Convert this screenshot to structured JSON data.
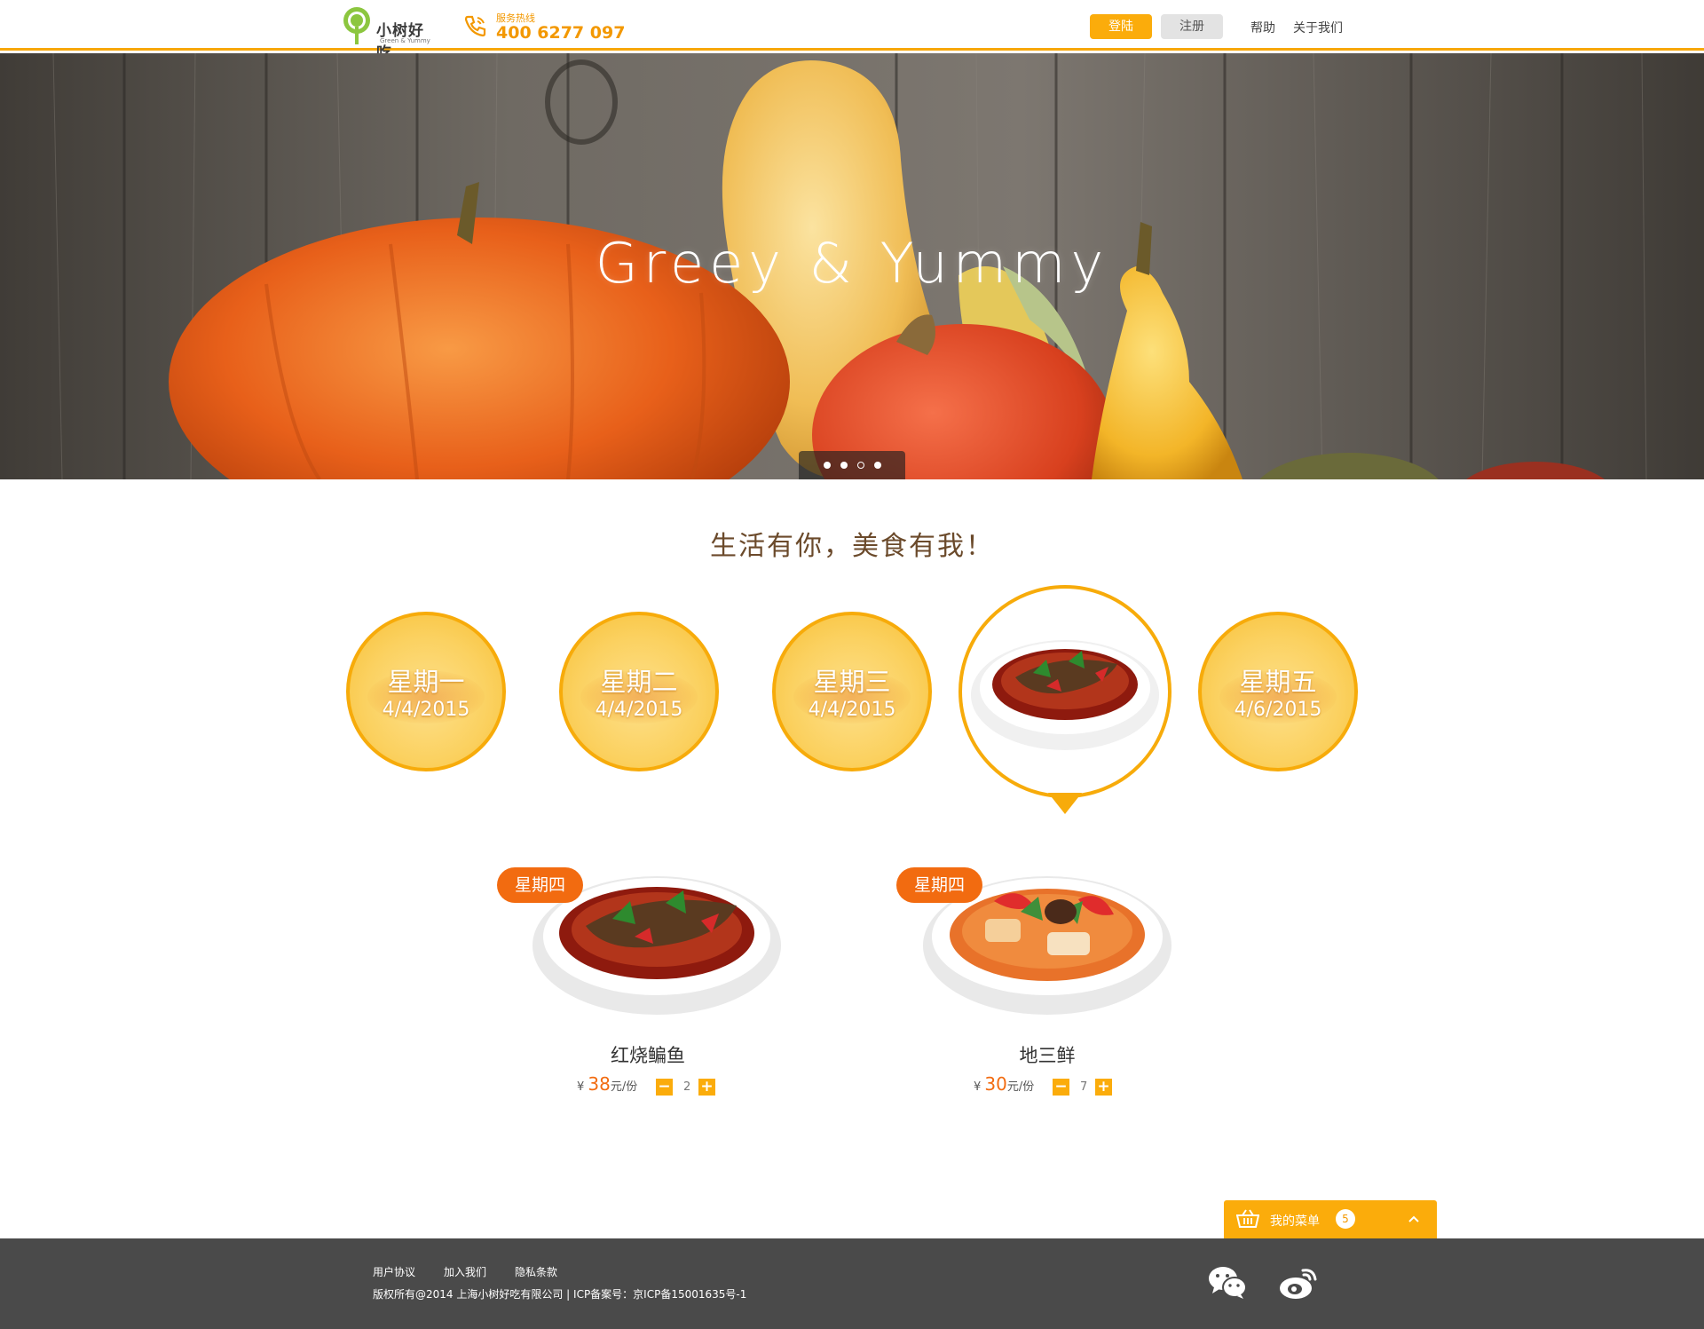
{
  "header": {
    "logo_text": "小树好吃",
    "logo_sub": "Green & Yummy",
    "hotline_label": "服务热线",
    "hotline_number": "400 6277 097",
    "login_label": "登陆",
    "register_label": "注册",
    "nav": [
      "帮助",
      "关于我们"
    ]
  },
  "banner": {
    "title": "Greey & Yummy",
    "slide_count": 4
  },
  "slogan": "生活有你，美食有我！",
  "days": [
    {
      "name": "星期一",
      "date": "4/4/2015"
    },
    {
      "name": "星期二",
      "date": "4/4/2015"
    },
    {
      "name": "星期三",
      "date": "4/4/2015"
    },
    {
      "name": "星期四",
      "date": "",
      "active": true
    },
    {
      "name": "星期五",
      "date": "4/6/2015"
    }
  ],
  "dishes": [
    {
      "tag": "星期四",
      "name": "红烧鳊鱼",
      "currency": "¥",
      "price": "38",
      "unit": "元/份",
      "qty": "2"
    },
    {
      "tag": "星期四",
      "name": "地三鲜",
      "currency": "¥",
      "price": "30",
      "unit": "元/份",
      "qty": "7"
    }
  ],
  "cart": {
    "label": "我的菜单",
    "count": "5"
  },
  "footer": {
    "links": [
      "用户协议",
      "加入我们",
      "隐私条款"
    ],
    "copyright": "版权所有@2014 上海小树好吃有限公司  |   ICP备案号：京ICP备15001635号-1"
  },
  "colors": {
    "accent": "#fbac0b",
    "tag": "#f26b10",
    "footer_bg": "#4a4a4a"
  }
}
